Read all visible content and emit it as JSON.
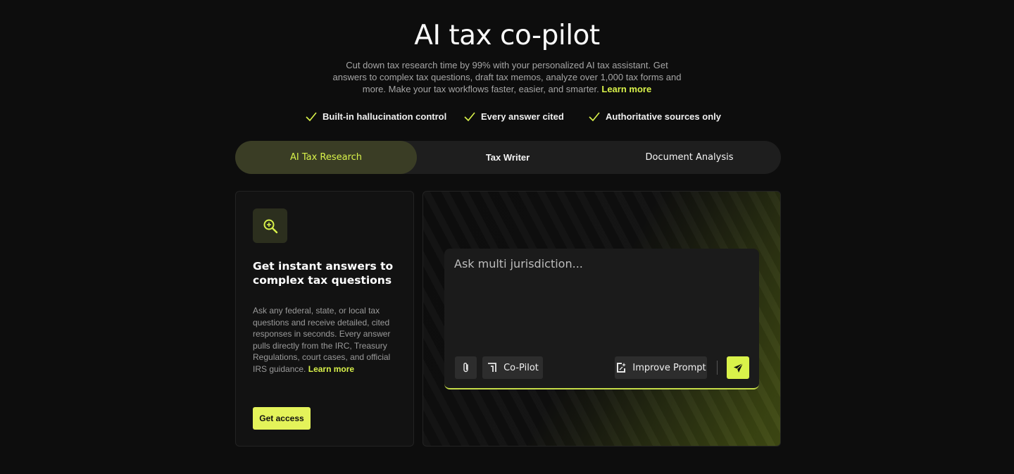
{
  "hero": {
    "title": "AI tax co-pilot",
    "description": "Cut down tax research time by 99% with your personalized AI tax assistant. Get answers to complex tax questions, draft tax memos, analyze over 1,000 tax forms and more. Make your tax workflows faster, easier, and smarter.",
    "learn_more": "Learn more"
  },
  "features": [
    {
      "label": "Built-in hallucination control",
      "icon": "check-icon"
    },
    {
      "label": "Every answer cited",
      "icon": "check-icon"
    },
    {
      "label": "Authoritative sources only",
      "icon": "check-icon"
    }
  ],
  "tabs": [
    {
      "label": "AI Tax Research",
      "active": true
    },
    {
      "label": "Tax Writer",
      "active": false
    },
    {
      "label": "Document Analysis",
      "active": false
    }
  ],
  "card": {
    "icon": "magnifier-icon",
    "title": "Get instant answers to complex tax questions",
    "description": "Ask any federal, state, or local tax questions and receive detailed, cited responses in seconds. Every answer pulls directly from the IRC, Treasury Regulations, court cases, and official IRS guidance.",
    "learn_more": "Learn more",
    "cta": "Get access"
  },
  "prompt": {
    "placeholder": "Ask multi jurisdiction...",
    "attach_icon": "paperclip-icon",
    "copilot_label": "Co-Pilot",
    "improve_label": "Improve Prompt",
    "send_icon": "send-icon"
  },
  "colors": {
    "accent": "#d9f24a",
    "background": "#0d0d0d",
    "active_tab_bg": "#3a3d25"
  }
}
